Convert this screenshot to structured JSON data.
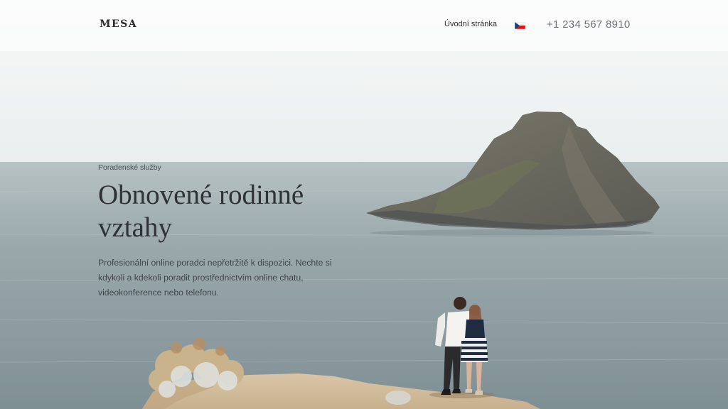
{
  "header": {
    "logo": "MESA",
    "nav_home": "Úvodní stránka",
    "language_icon": "czech-flag-icon",
    "phone": "+1 234 567 8910"
  },
  "hero": {
    "eyebrow": "Poradenské služby",
    "headline": "Obnovené rodinné vztahy",
    "lead": "Profesionální online poradci nepřetržitě k dispozici. Nechte si kdykoli a kdekoli poradit prostřednictvím online chatu, videokonference nebo telefonu."
  },
  "colors": {
    "sky": "#f3f6f5",
    "sea": "#8a9aa0",
    "text_dark": "#2f3236",
    "phone_grey": "#6f7277"
  }
}
